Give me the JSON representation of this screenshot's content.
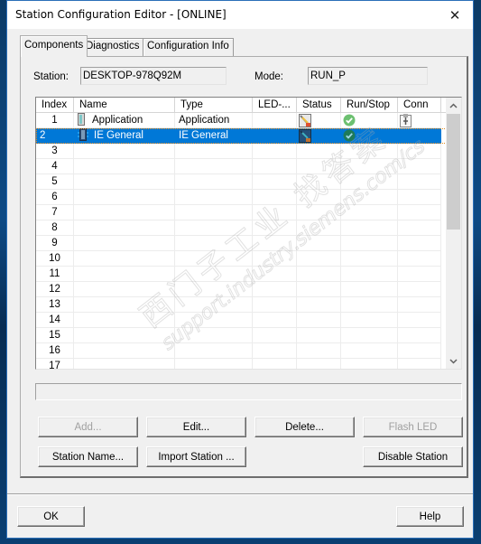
{
  "window": {
    "title": "Station Configuration Editor - [ONLINE]",
    "close_glyph": "✕"
  },
  "tabs": [
    {
      "label": "Components",
      "active": true
    },
    {
      "label": "Diagnostics",
      "active": false
    },
    {
      "label": "Configuration Info",
      "active": false
    }
  ],
  "station": {
    "label": "Station:",
    "value": "DESKTOP-978Q92M"
  },
  "mode": {
    "label": "Mode:",
    "value": "RUN_P"
  },
  "grid": {
    "columns": [
      "Index",
      "Name",
      "Type",
      "LED-...",
      "Status",
      "Run/Stop",
      "Conn"
    ],
    "rows": [
      {
        "index": "1",
        "name": "Application",
        "name_icon": "application-icon",
        "type": "Application",
        "led": "",
        "status_icon": "status-diagnostic-icon",
        "runstop_icon": "run-check-icon",
        "conn_icon": "connection-icon",
        "selected": false
      },
      {
        "index": "2",
        "name": "IE General",
        "name_icon": "ie-general-icon",
        "type": "IE General",
        "led": "",
        "status_icon": "status-diagnostic-icon",
        "runstop_icon": "run-check-icon",
        "conn_icon": "",
        "selected": true
      },
      {
        "index": "3"
      },
      {
        "index": "4"
      },
      {
        "index": "5"
      },
      {
        "index": "6"
      },
      {
        "index": "7"
      },
      {
        "index": "8"
      },
      {
        "index": "9"
      },
      {
        "index": "10"
      },
      {
        "index": "11"
      },
      {
        "index": "12"
      },
      {
        "index": "13"
      },
      {
        "index": "14"
      },
      {
        "index": "15"
      },
      {
        "index": "16"
      },
      {
        "index": "17"
      }
    ],
    "scroll_up_glyph": "⌃",
    "scroll_down_glyph": "⌄"
  },
  "message_bar": "",
  "buttons": {
    "add": {
      "label": "Add...",
      "enabled": false
    },
    "edit": {
      "label": "Edit...",
      "enabled": true
    },
    "delete": {
      "label": "Delete...",
      "enabled": true
    },
    "flash_led": {
      "label": "Flash LED",
      "enabled": false
    },
    "station_name": {
      "label": "Station Name...",
      "enabled": true
    },
    "import_station": {
      "label": "Import Station ...",
      "enabled": true
    },
    "disable_station": {
      "label": "Disable Station",
      "enabled": true
    },
    "ok": {
      "label": "OK",
      "enabled": true
    },
    "help": {
      "label": "Help",
      "enabled": true
    }
  },
  "watermark": {
    "line1": "西门子工业 找答案",
    "line2": "support.industry.siemens.com/cs"
  },
  "colors": {
    "selection": "#0078d7",
    "run_ok": "#5cb85c",
    "run_ok_selected": "#1e7a5a"
  }
}
